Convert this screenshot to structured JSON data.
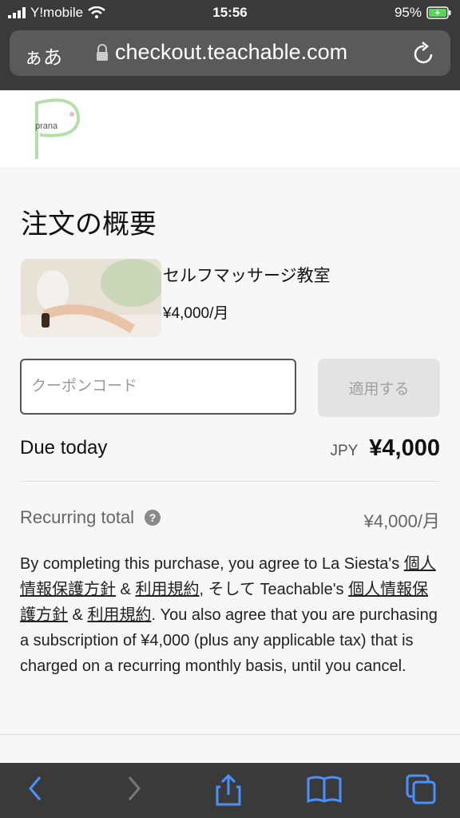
{
  "status": {
    "carrier": "Y!mobile",
    "time": "15:56",
    "battery": "95%"
  },
  "browser": {
    "text_size": "ぁあ",
    "url": "checkout.teachable.com"
  },
  "logo": {
    "text": "prana"
  },
  "order": {
    "title": "注文の概要",
    "product_name": "セルフマッサージ教室",
    "product_price": "¥4,000/月",
    "coupon_placeholder": "クーポンコード",
    "apply_label": "適用する",
    "due_label": "Due today",
    "due_currency": "JPY",
    "due_amount": "¥4,000",
    "recurring_label": "Recurring total",
    "recurring_amount": "¥4,000/月"
  },
  "terms": {
    "p1": "By completing this purchase, you agree to La Siesta's ",
    "privacy1": "個人情報保護方針",
    "amp1": " & ",
    "terms1": "利用規約",
    "p2": ", そして Teachable's ",
    "privacy2": "個人情報保護方針",
    "amp2": " & ",
    "terms2": "利用規約",
    "p3": ". You also agree that you are purchasing a subscription of ¥4,000 (plus any applicable tax) that is charged on a recurring monthly basis, until you cancel."
  },
  "colors": {
    "bar": "#3a3a3a",
    "accent_ios": "#4a90ff",
    "logo_green": "#a9d8a0"
  }
}
